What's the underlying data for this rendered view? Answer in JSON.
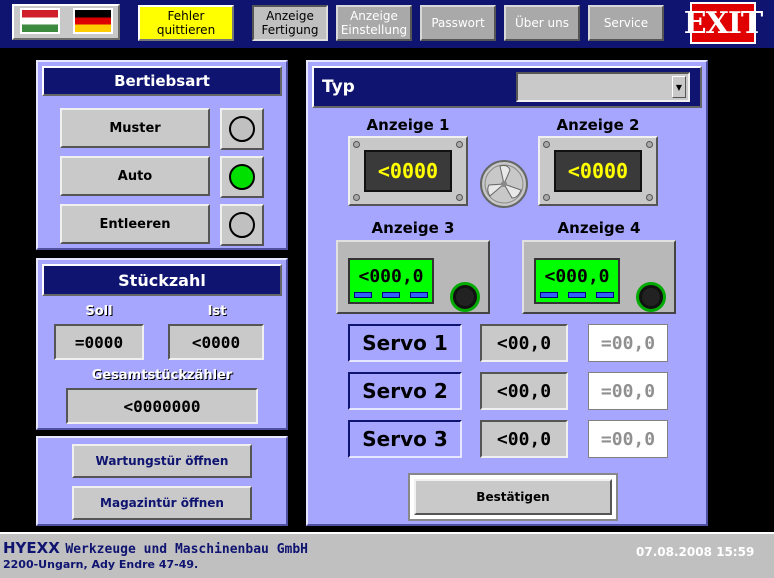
{
  "header": {
    "languages": [
      {
        "name": "hungarian-flag"
      },
      {
        "name": "german-flag"
      }
    ],
    "fehler_label": "Fehler\nquittieren",
    "anzeige_fertigung_label": "Anzeige\nFertigung",
    "anzeige_einstellung_label": "Anzeige\nEinstellung",
    "passwort_label": "Passwort",
    "ueber_uns_label": "Über uns",
    "service_label": "Service",
    "exit_label": "EXIT"
  },
  "betriebsart": {
    "title": "Bertiebsart",
    "muster_label": "Muster",
    "auto_label": "Auto",
    "entleeren_label": "Entleeren",
    "active": "Auto"
  },
  "stueckzahl": {
    "title": "Stückzahl",
    "soll_label": "Soll",
    "ist_label": "Ist",
    "soll_value": "=0000",
    "ist_value": "<0000",
    "gesamt_label": "Gesamtstückzähler",
    "gesamt_value": "<0000000"
  },
  "doors": {
    "wartung_label": "Wartungstür öffnen",
    "magazin_label": "Magazintür öffnen"
  },
  "typ": {
    "title": "Typ",
    "selected": ""
  },
  "anzeigen": [
    {
      "label": "Anzeige 1",
      "value": "<0000"
    },
    {
      "label": "Anzeige 2",
      "value": "<0000"
    },
    {
      "label": "Anzeige 3",
      "value": "<000,0"
    },
    {
      "label": "Anzeige 4",
      "value": "<000,0"
    }
  ],
  "servos": [
    {
      "label": "Servo 1",
      "actual": "<00,0",
      "setpoint": "=00,0"
    },
    {
      "label": "Servo 2",
      "actual": "<00,0",
      "setpoint": "=00,0"
    },
    {
      "label": "Servo 3",
      "actual": "<00,0",
      "setpoint": "=00,0"
    }
  ],
  "confirm_label": "Bestätigen",
  "footer": {
    "company_brand": "HYEXX",
    "company_rest": "Werkzeuge und Maschinenbau GmbH",
    "address": "2200-Ungarn, Ady Endre 47-49.",
    "datetime": "07.08.2008 15:59"
  },
  "colors": {
    "navy": "#0e1470",
    "panel": "#a6a6ff",
    "lamp_on": "#00e000",
    "display_text": "#ffff00",
    "exit": "#e00000"
  }
}
